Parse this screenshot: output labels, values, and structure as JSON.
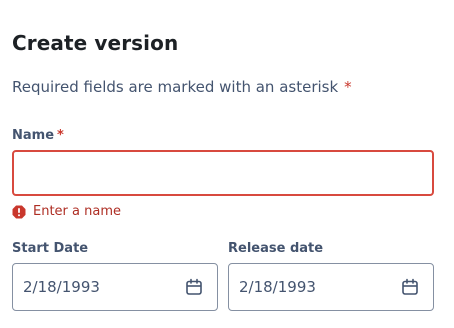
{
  "form": {
    "title": "Create version",
    "required_note": "Required fields are marked with an asterisk",
    "required_marker": "*",
    "name_field": {
      "label": "Name",
      "required_marker": "*",
      "value": "",
      "error": "Enter a name"
    },
    "start_date": {
      "label": "Start Date",
      "value": "2/18/1993",
      "icon": "calendar-icon"
    },
    "release_date": {
      "label": "Release date",
      "value": "2/18/1993",
      "icon": "calendar-icon"
    }
  },
  "colors": {
    "error_border": "#d84a3f",
    "error_text": "#ae2e24",
    "asterisk": "#c9372c",
    "field_border": "#8590a2"
  }
}
